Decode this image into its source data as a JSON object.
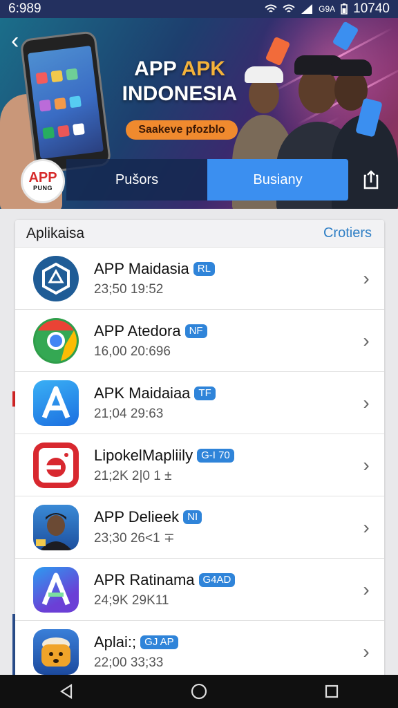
{
  "status_bar": {
    "time": "6:989",
    "right_text": "10740",
    "network": "G9A"
  },
  "hero": {
    "title_line1_a": "APP",
    "title_line1_b": "APK",
    "title_line2": "INDONESIA",
    "pill_text": "Saakeve pfozblo",
    "logo_top": "APP",
    "logo_bottom": "PUNG"
  },
  "tabs": [
    {
      "label": "Pušors",
      "active": false
    },
    {
      "label": "Busiany",
      "active": true
    }
  ],
  "list": {
    "title": "Aplikaisa",
    "action": "Crotiers",
    "items": [
      {
        "name": "APP Maidasia",
        "tag": "RL",
        "meta": "23;50  19:52",
        "icon": "hexagon-app-icon"
      },
      {
        "name": "APP Atedora",
        "tag": "NF",
        "meta": "16,00  20:696",
        "icon": "chrome-icon"
      },
      {
        "name": "APK Maidaiaa",
        "tag": "TF",
        "meta": "21;04  29:63",
        "icon": "a-letter-icon"
      },
      {
        "name": "LipokelMapliily",
        "tag": "G-I 70",
        "meta": "21;2K  2|0 1 ±",
        "icon": "red-camera-icon"
      },
      {
        "name": "APP Delieek",
        "tag": "NI",
        "meta": "23;30  26<1 ∓",
        "icon": "man-portrait-icon"
      },
      {
        "name": "APR Ratinama",
        "tag": "G4AD",
        "meta": "24;9K  29K11",
        "icon": "gradient-a-icon"
      },
      {
        "name": "Aplai:;",
        "tag": "GJ AP",
        "meta": "22;00  33;33",
        "icon": "rice-cooker-icon"
      }
    ]
  },
  "colors": {
    "accent": "#3b8ff0",
    "tag": "#2f84d9",
    "brand_orange": "#f08a2e"
  }
}
